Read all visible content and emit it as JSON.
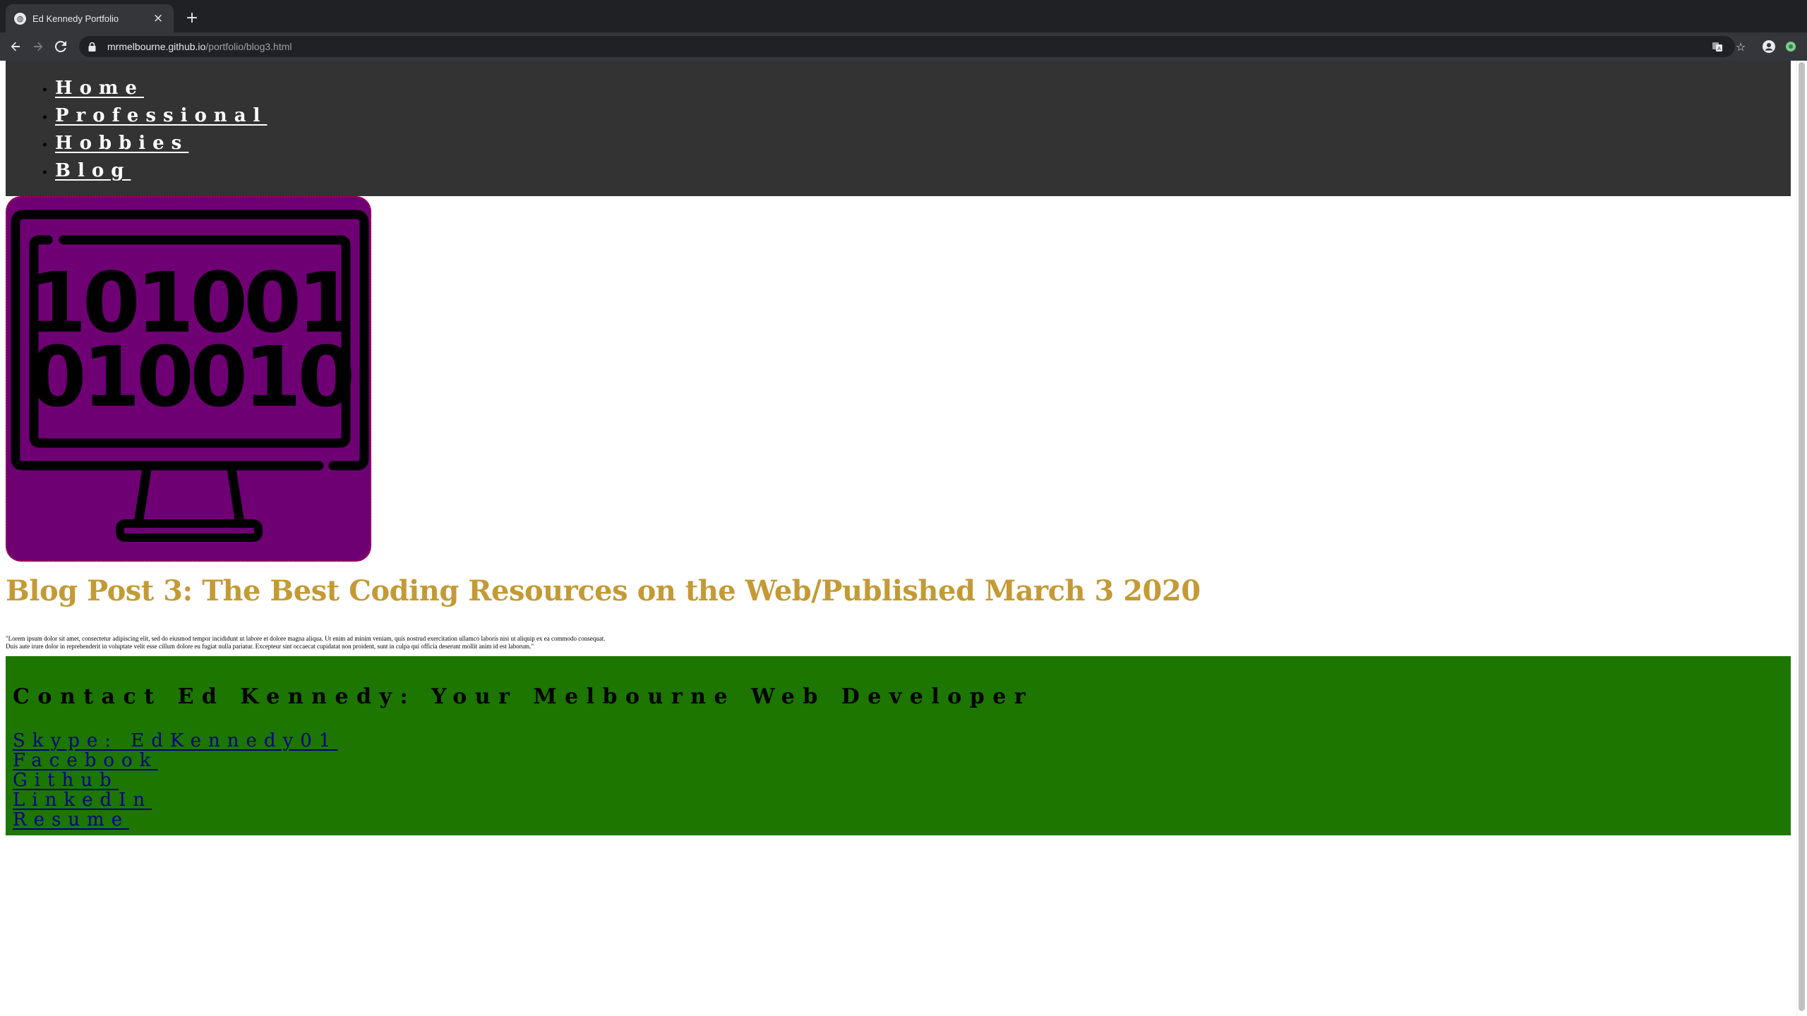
{
  "browser": {
    "tab_title": "Ed Kennedy Portfolio",
    "url_host": "mrmelbourne.github.io",
    "url_path": "/portfolio/blog3.html",
    "icons": {
      "favicon": "globe-icon",
      "close": "close-icon",
      "new_tab": "plus-icon",
      "back": "back-arrow-icon",
      "forward": "forward-arrow-icon",
      "reload": "reload-icon",
      "lock": "lock-icon",
      "translate": "translate-icon",
      "bookmark": "star-icon",
      "profile": "profile-icon",
      "extension": "extension-icon"
    }
  },
  "nav": {
    "items": [
      {
        "label": "Home"
      },
      {
        "label": "Professional"
      },
      {
        "label": "Hobbies"
      },
      {
        "label": "Blog"
      }
    ]
  },
  "hero": {
    "binary_line_1": "101001",
    "binary_line_2": "010010",
    "icon": "computer-monitor-binary-icon",
    "background_color": "#6f0074"
  },
  "post": {
    "title": "Blog Post 3: The Best Coding Resources on the Web/Published March 3 2020",
    "body_line_1": "\"Lorem ipsum dolor sit amet, consectetur adipiscing elit, sed do eiusmod tempor incididunt ut labore et dolore magna aliqua. Ut enim ad minim veniam, quis nostrud exercitation ullamco laboris nisi ut aliquip ex ea commodo consequat.",
    "body_line_2": "Duis aute irure dolor in reprehenderit in voluptate velit esse cillum dolore eu fugiat nulla pariatur. Excepteur sint occaecat cupidatat non proident, sunt in culpa qui officia deserunt mollit anim id est laborum.\"",
    "title_color": "#c49a35"
  },
  "contact": {
    "heading": "Contact Ed Kennedy: Your Melbourne Web Developer",
    "links": [
      {
        "label": "Skype: EdKennedy01"
      },
      {
        "label": "Facebook"
      },
      {
        "label": "Github"
      },
      {
        "label": "LinkedIn"
      },
      {
        "label": "Resume"
      }
    ],
    "background_color": "#1c7600"
  }
}
